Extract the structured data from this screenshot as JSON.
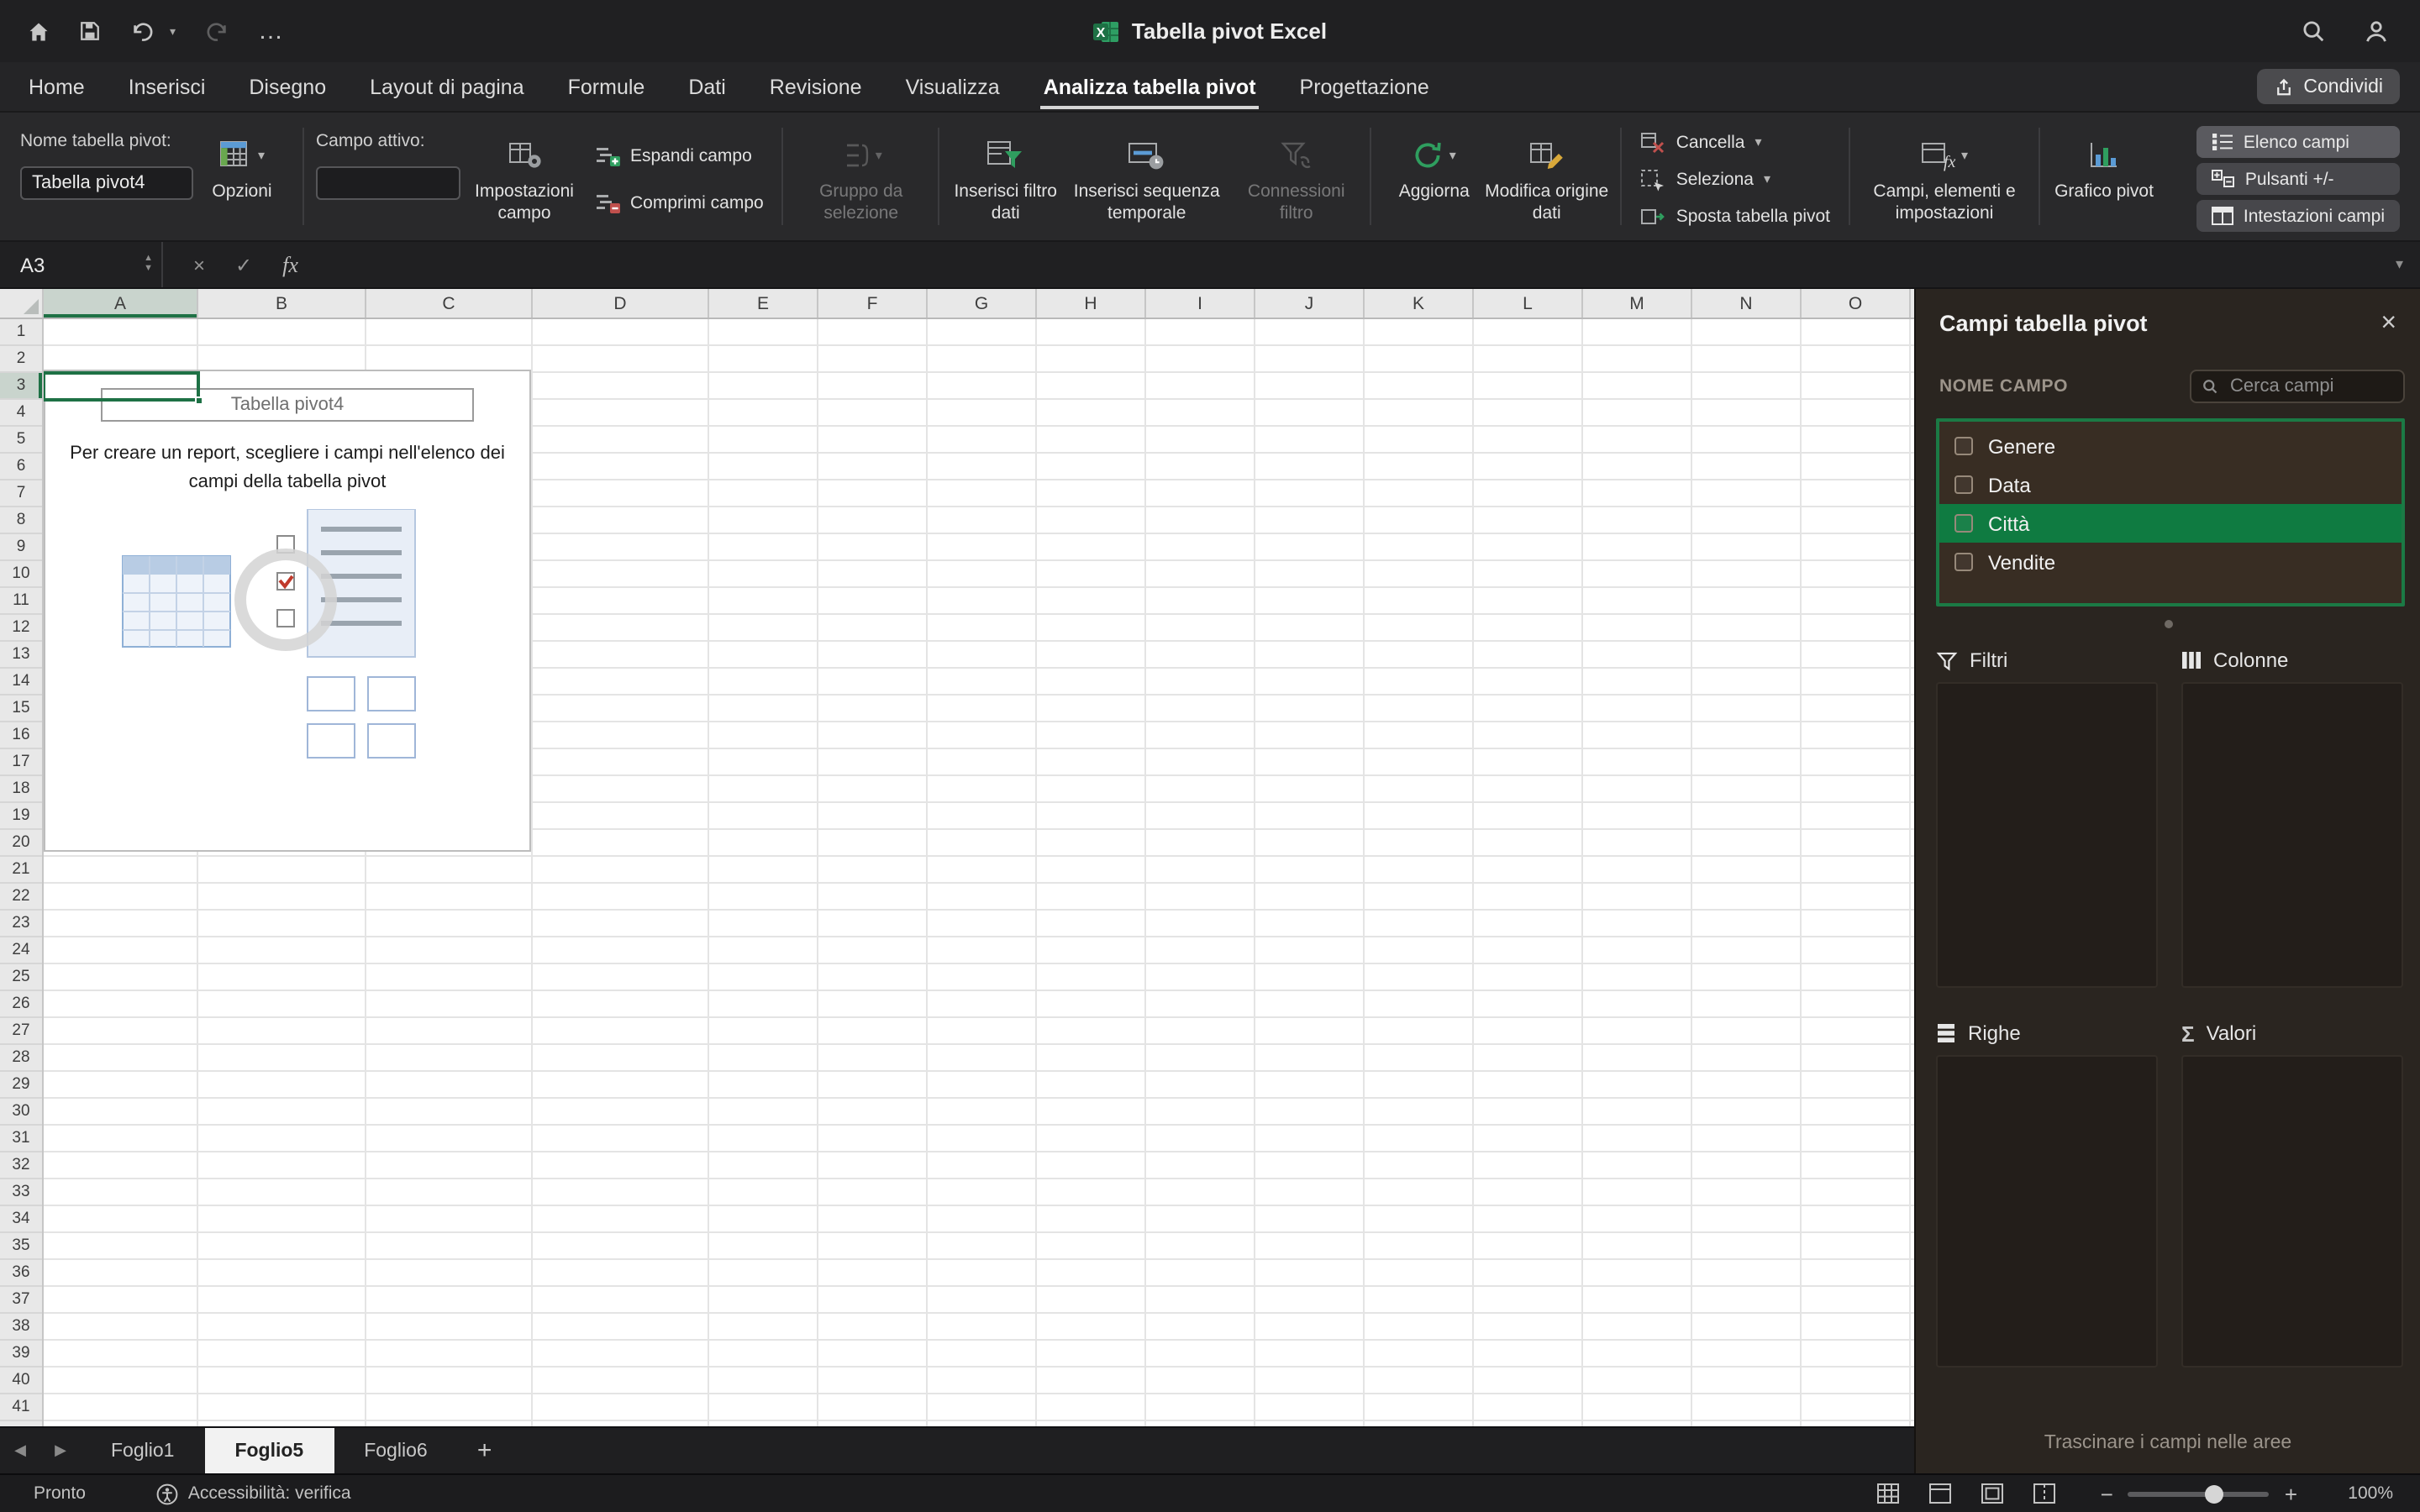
{
  "titlebar": {
    "title": "Tabella pivot Excel"
  },
  "glyphs": {
    "caret": "▾",
    "ellipsis": "…",
    "close": "×",
    "cancel": "×",
    "check": "✓",
    "sigma": "Σ",
    "spin_up": "▲",
    "spin_down": "▼",
    "nav_left": "◀",
    "nav_right": "▶",
    "add": "+",
    "minus": "−",
    "plus": "+"
  },
  "ribbon_tabs": {
    "items": [
      {
        "label": "Home"
      },
      {
        "label": "Inserisci"
      },
      {
        "label": "Disegno"
      },
      {
        "label": "Layout di pagina"
      },
      {
        "label": "Formule"
      },
      {
        "label": "Dati"
      },
      {
        "label": "Revisione"
      },
      {
        "label": "Visualizza"
      },
      {
        "label": "Analizza tabella pivot",
        "active": true
      },
      {
        "label": "Progettazione"
      }
    ],
    "share_label": "Condividi"
  },
  "ribbon": {
    "pivot_name_label": "Nome tabella pivot:",
    "pivot_name_value": "Tabella pivot4",
    "options_label": "Opzioni",
    "active_field_label": "Campo attivo:",
    "field_settings_label": "Impostazioni campo",
    "expand_label": "Espandi campo",
    "collapse_label": "Comprimi campo",
    "group_selection_label": "Gruppo da selezione",
    "insert_slicer_label": "Inserisci filtro dati",
    "insert_timeline_label": "Inserisci sequenza temporale",
    "filter_connections_label": "Connessioni filtro",
    "refresh_label": "Aggiorna",
    "change_data_source_label": "Modifica origine dati",
    "clear_label": "Cancella",
    "select_label": "Seleziona",
    "move_pivot_label": "Sposta tabella pivot",
    "fields_items_label": "Campi, elementi e impostazioni",
    "pivot_chart_label": "Grafico pivot",
    "field_list_label": "Elenco campi",
    "plus_minus_label": "Pulsanti +/-",
    "field_headers_label": "Intestazioni campi"
  },
  "formula_bar": {
    "cell_ref": "A3",
    "fx_label": "fx"
  },
  "grid": {
    "columns": [
      "A",
      "B",
      "C",
      "D",
      "E",
      "F",
      "G",
      "H",
      "I",
      "J",
      "K",
      "L",
      "M",
      "N",
      "O"
    ],
    "row_count": 41,
    "selection": {
      "cell": "A3",
      "col": "A",
      "row": 3
    }
  },
  "placeholder": {
    "title": "Tabella pivot4",
    "body": "Per creare un report, scegliere i campi nell'elenco dei campi della tabella pivot"
  },
  "panel": {
    "title": "Campi tabella pivot",
    "field_section_label": "NOME CAMPO",
    "search_placeholder": "Cerca campi",
    "fields": [
      {
        "label": "Genere"
      },
      {
        "label": "Data"
      },
      {
        "label": "Città",
        "selected": true
      },
      {
        "label": "Vendite"
      }
    ],
    "areas": {
      "filters": "Filtri",
      "columns": "Colonne",
      "rows": "Righe",
      "values": "Valori"
    },
    "hint": "Trascinare i campi nelle aree"
  },
  "sheetbar": {
    "sheets": [
      {
        "label": "Foglio1"
      },
      {
        "label": "Foglio5",
        "active": true
      },
      {
        "label": "Foglio6"
      }
    ],
    "add_label": "+"
  },
  "statusbar": {
    "ready": "Pronto",
    "accessibility": "Accessibilità: verifica",
    "zoom": "100%"
  },
  "colors": {
    "accent_green": "#107C41",
    "selection_green": "#1E7145"
  }
}
